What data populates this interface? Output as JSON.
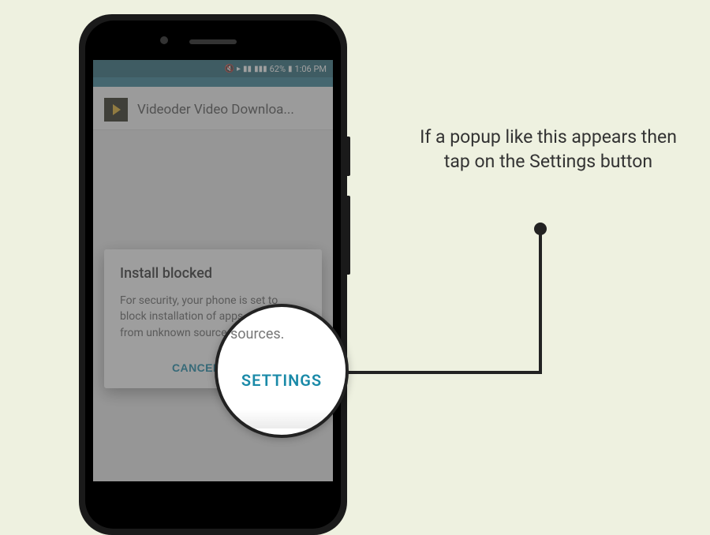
{
  "status_bar": {
    "battery_pct": "62%",
    "time": "1:06 PM"
  },
  "app": {
    "title": "Videoder Video Downloa..."
  },
  "dialog": {
    "title": "Install blocked",
    "body": "For security, your phone is set to block installation of apps obtained from unknown sources.",
    "cancel": "CANCEL",
    "settings": "SETTINGS"
  },
  "magnifier": {
    "partial_text": "sources.",
    "settings": "SETTINGS"
  },
  "instruction": "If a popup like this appears then tap on the Settings button"
}
